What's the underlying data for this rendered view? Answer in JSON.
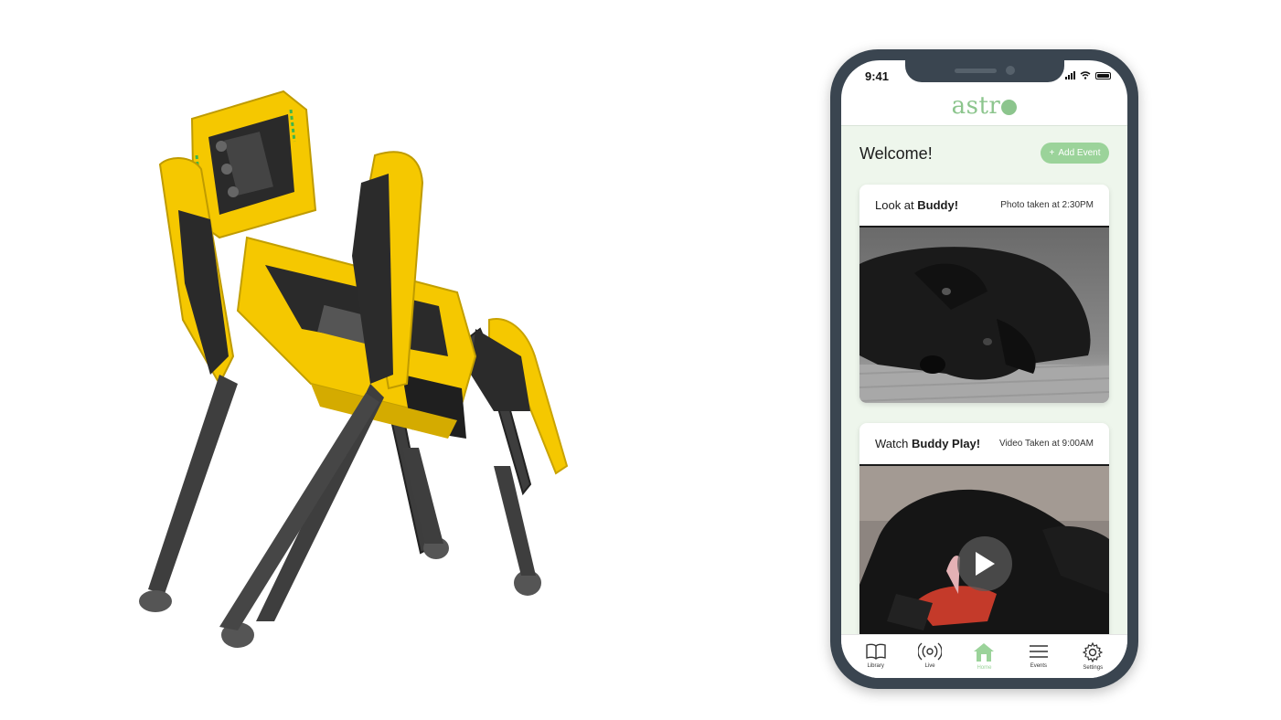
{
  "phone": {
    "status_time": "9:41",
    "app_logo_text": "astr",
    "welcome": "Welcome!",
    "add_event_label": "Add Event",
    "cards": [
      {
        "title_prefix": "Look at ",
        "title_bold": "Buddy!",
        "meta": "Photo taken at 2:30PM",
        "media": "photo"
      },
      {
        "title_prefix": "Watch ",
        "title_bold": "Buddy Play!",
        "meta": "Video Taken at 9:00AM",
        "media": "video"
      }
    ],
    "tabs": [
      {
        "label": "Library",
        "icon": "book-icon",
        "active": false
      },
      {
        "label": "Live",
        "icon": "broadcast-icon",
        "active": false
      },
      {
        "label": "Home",
        "icon": "house-icon",
        "active": true
      },
      {
        "label": "Events",
        "icon": "menu-icon",
        "active": false
      },
      {
        "label": "Settings",
        "icon": "gear-icon",
        "active": false
      }
    ]
  },
  "colors": {
    "accent": "#9bd39a",
    "logo": "#8cc58d",
    "content_bg": "#eef6ec",
    "phone_frame": "#3a4550",
    "robot_yellow": "#f5c800"
  }
}
